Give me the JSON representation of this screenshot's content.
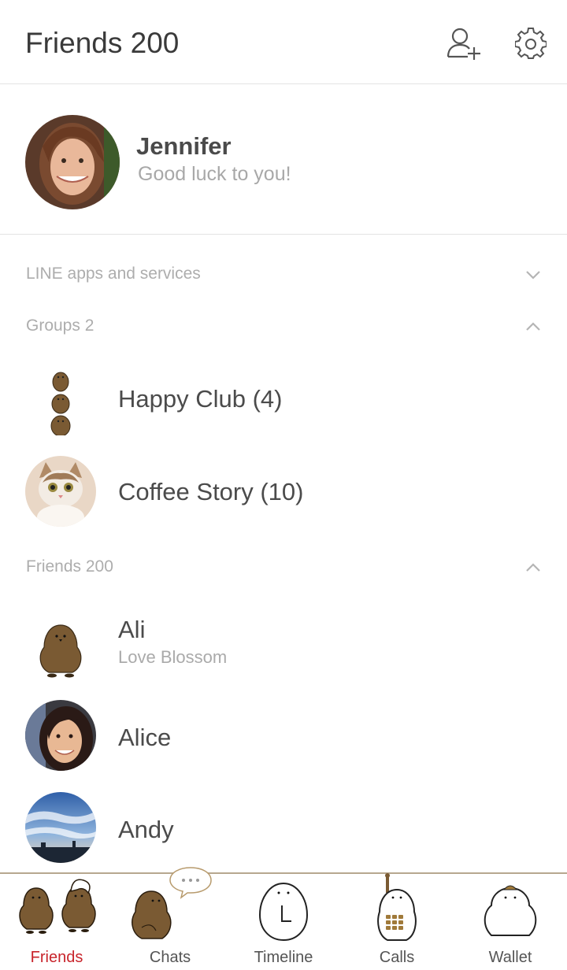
{
  "header": {
    "title": "Friends 200",
    "add_friend_icon": "add-friend-icon",
    "settings_icon": "gear-icon"
  },
  "profile": {
    "name": "Jennifer",
    "status": "Good luck to you!"
  },
  "sections": {
    "services": {
      "label": "LINE apps and services",
      "state": "collapsed"
    },
    "groups": {
      "label": "Groups 2",
      "state": "expanded"
    },
    "friends": {
      "label": "Friends 200",
      "state": "expanded"
    }
  },
  "groups": [
    {
      "name": "Happy Club (4)"
    },
    {
      "name": "Coffee Story (10)"
    }
  ],
  "friends": [
    {
      "name": "Ali",
      "status": "Love Blossom"
    },
    {
      "name": "Alice",
      "status": ""
    },
    {
      "name": "Andy",
      "status": ""
    }
  ],
  "tabs": [
    {
      "label": "Friends",
      "active": true
    },
    {
      "label": "Chats",
      "active": false
    },
    {
      "label": "Timeline",
      "active": false
    },
    {
      "label": "Calls",
      "active": false
    },
    {
      "label": "Wallet",
      "active": false
    }
  ],
  "colors": {
    "accent_active": "#c8242b",
    "character_brown": "#7a5a33",
    "divider": "#e3e3e3",
    "tabbar_border": "#b7a78f"
  }
}
